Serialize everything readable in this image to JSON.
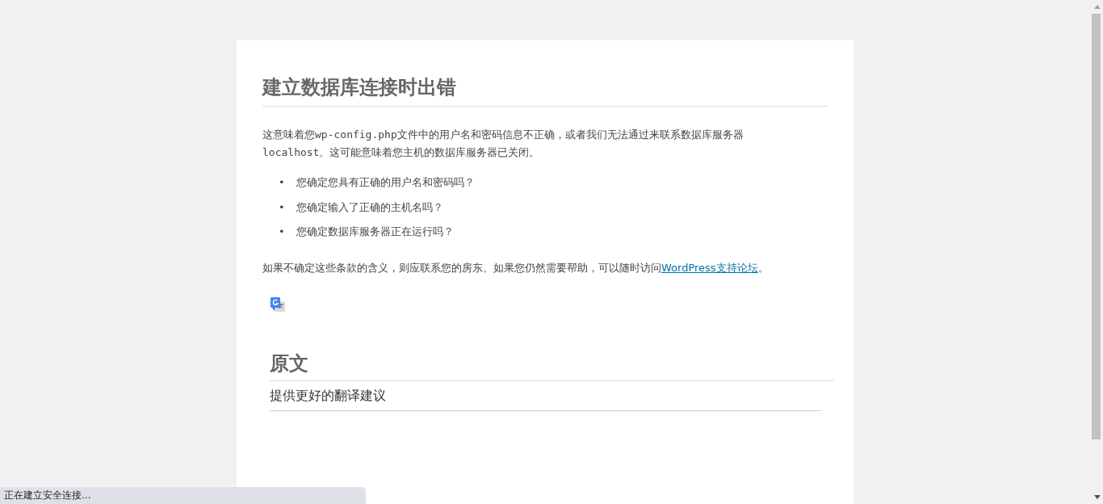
{
  "error_page": {
    "heading": "建立数据库连接时出错",
    "intro": [
      {
        "kind": "text",
        "text": "这意味着您"
      },
      {
        "kind": "code",
        "text": "wp-config.php"
      },
      {
        "kind": "text",
        "text": "文件中的用户名和密码信息不正确，或者我们无法通过来联系数据库服务器"
      },
      {
        "kind": "code",
        "text": "localhost"
      },
      {
        "kind": "text",
        "text": "。这可能意味着您主机的数据库服务器已关闭。"
      }
    ],
    "questions": [
      {
        "marker": "•",
        "text": "您确定您具有正确的用户名和密码吗？"
      },
      {
        "marker": "•",
        "text": "您确定输入了正确的主机名吗？"
      },
      {
        "marker": "•",
        "text": "您确定数据库服务器正在运行吗？"
      }
    ],
    "help": {
      "before": "如果不确定这些条款的含义，则应联系您的房东。如果您仍然需要帮助，可以随时访问",
      "link": "WordPress支持论坛",
      "after": "。"
    }
  },
  "translate_panel": {
    "heading": "原文",
    "suggestion": "提供更好的翻译建议"
  },
  "status_bar": "正在建立安全连接..."
}
